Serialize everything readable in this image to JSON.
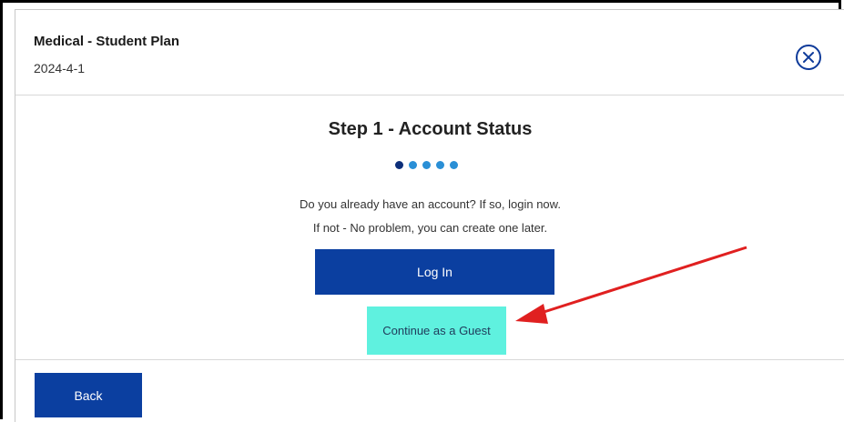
{
  "header": {
    "plan_title": "Medical - Student Plan",
    "plan_date": "2024-4-1",
    "close_icon": "close-circle-icon"
  },
  "step": {
    "title": "Step 1 - Account Status",
    "progress": {
      "current": 1,
      "total": 5
    },
    "prompt_line1": "Do you already have an account? If so, login now.",
    "prompt_line2": "If not - No problem, you can create one later."
  },
  "actions": {
    "login_label": "Log In",
    "guest_label": "Continue as a Guest",
    "back_label": "Back"
  },
  "colors": {
    "primary": "#0b3fa0",
    "guest_button": "#5ff1df",
    "dot_active": "#0d2f7a",
    "dot_inactive": "#2a8fd6",
    "annotation_arrow": "#e02020"
  }
}
